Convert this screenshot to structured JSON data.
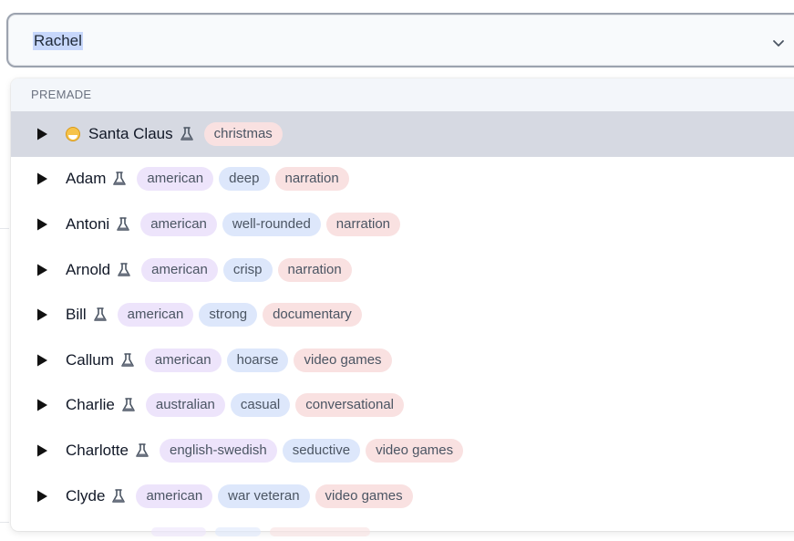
{
  "select": {
    "value": "Rachel"
  },
  "menu": {
    "group_label": "PREMADE",
    "options": [
      {
        "name": "Santa Claus",
        "emoji": "smiling-face-with-halo-icon",
        "tags": [
          {
            "label": "christmas",
            "color": "red"
          }
        ]
      },
      {
        "name": "Adam",
        "tags": [
          {
            "label": "american",
            "color": "purple"
          },
          {
            "label": "deep",
            "color": "blue"
          },
          {
            "label": "narration",
            "color": "red"
          }
        ]
      },
      {
        "name": "Antoni",
        "tags": [
          {
            "label": "american",
            "color": "purple"
          },
          {
            "label": "well-rounded",
            "color": "blue"
          },
          {
            "label": "narration",
            "color": "red"
          }
        ]
      },
      {
        "name": "Arnold",
        "tags": [
          {
            "label": "american",
            "color": "purple"
          },
          {
            "label": "crisp",
            "color": "blue"
          },
          {
            "label": "narration",
            "color": "red"
          }
        ]
      },
      {
        "name": "Bill",
        "tags": [
          {
            "label": "american",
            "color": "purple"
          },
          {
            "label": "strong",
            "color": "blue"
          },
          {
            "label": "documentary",
            "color": "red"
          }
        ]
      },
      {
        "name": "Callum",
        "tags": [
          {
            "label": "american",
            "color": "purple"
          },
          {
            "label": "hoarse",
            "color": "blue"
          },
          {
            "label": "video games",
            "color": "red"
          }
        ]
      },
      {
        "name": "Charlie",
        "tags": [
          {
            "label": "australian",
            "color": "purple"
          },
          {
            "label": "casual",
            "color": "blue"
          },
          {
            "label": "conversational",
            "color": "red"
          }
        ]
      },
      {
        "name": "Charlotte",
        "tags": [
          {
            "label": "english-swedish",
            "color": "purple"
          },
          {
            "label": "seductive",
            "color": "blue"
          },
          {
            "label": "video games",
            "color": "red"
          }
        ]
      },
      {
        "name": "Clyde",
        "tags": [
          {
            "label": "american",
            "color": "purple"
          },
          {
            "label": "war veteran",
            "color": "blue"
          },
          {
            "label": "video games",
            "color": "red"
          }
        ]
      }
    ]
  },
  "colors": {
    "highlight": "#d6d9e2",
    "tag_purple": "#ede4fb",
    "tag_blue": "#dde7fb",
    "tag_red": "#f9e1e1"
  }
}
